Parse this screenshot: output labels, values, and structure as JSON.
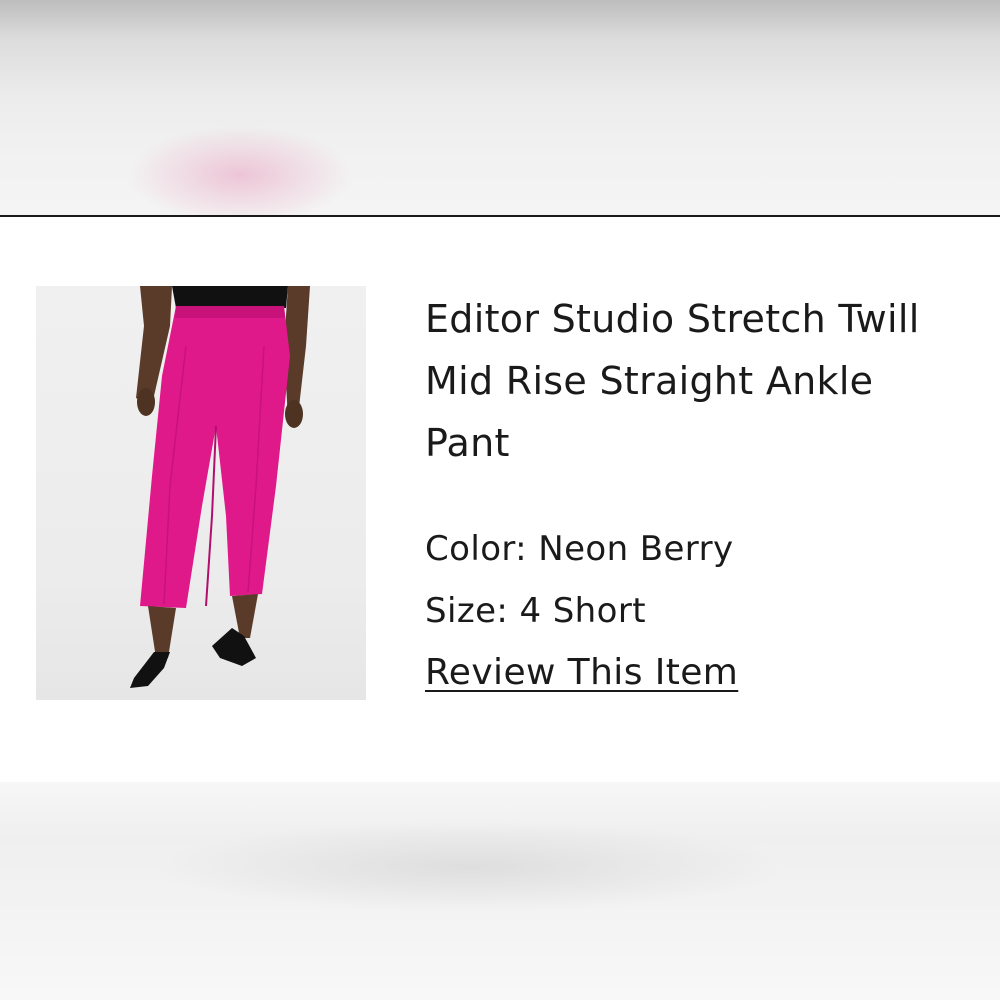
{
  "product": {
    "title": "Editor Studio Stretch Twill Mid Rise Straight Ankle Pant",
    "color_label": "Color: Neon Berry",
    "size_label": "Size: 4 Short",
    "review_link": "Review This Item",
    "image_icon": "pants-product-photo",
    "accent_color": "#e0198a"
  }
}
